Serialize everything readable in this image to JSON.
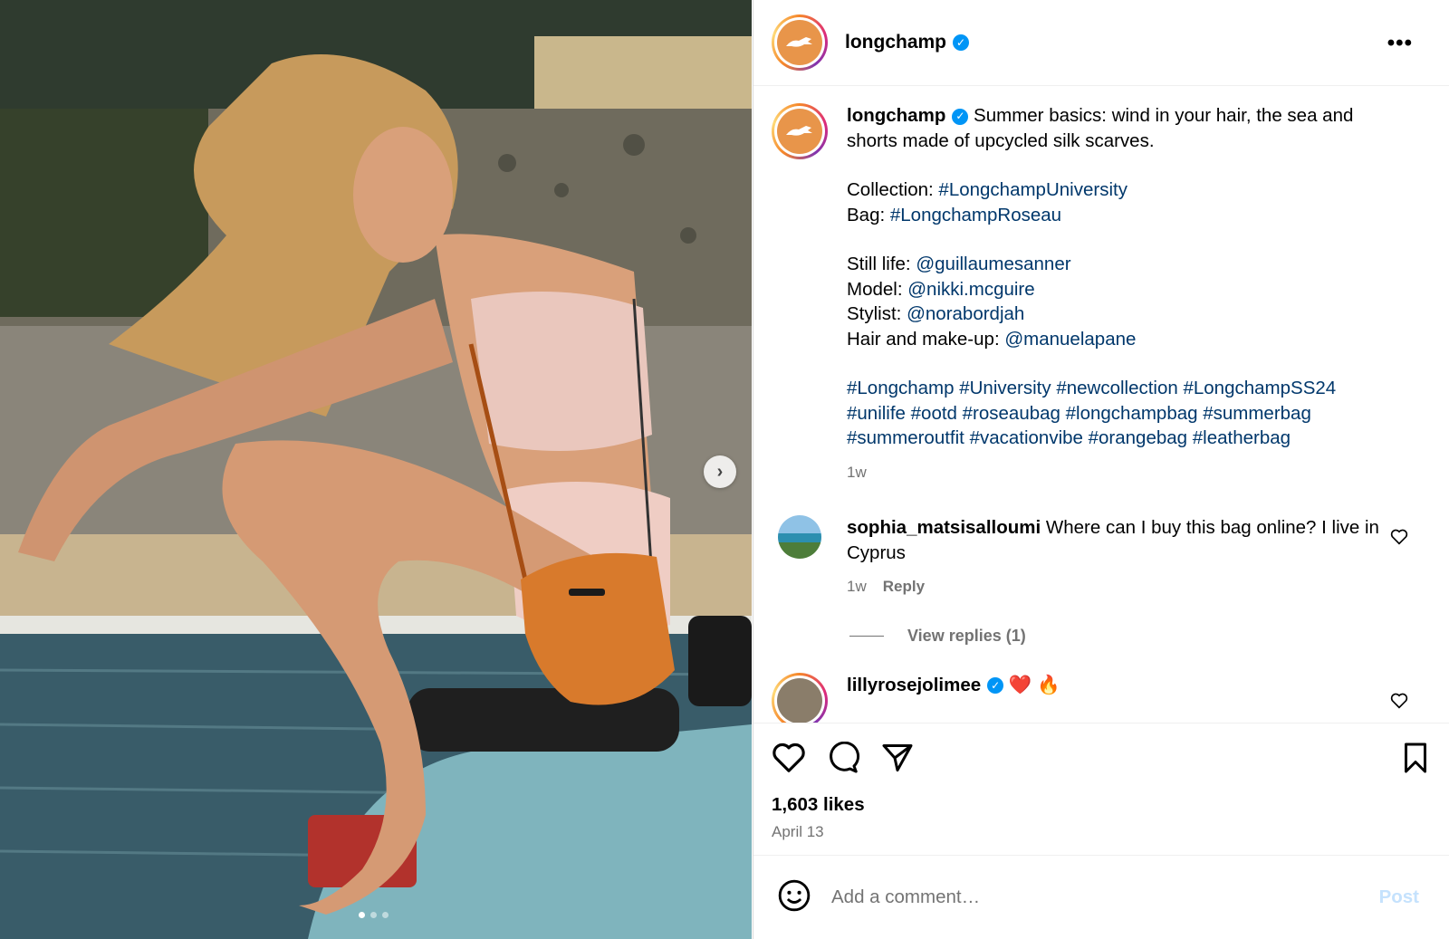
{
  "header": {
    "username": "longchamp",
    "more_label": "•••"
  },
  "caption": {
    "username": "longchamp",
    "text": "Summer basics: wind in your hair, the sea and shorts made of upcycled silk scarves.",
    "collection_label": "Collection: ",
    "collection_tag": "#LongchampUniversity",
    "bag_label": "Bag: ",
    "bag_tag": "#LongchampRoseau",
    "still_label": "Still life: ",
    "still_handle": "@guillaumesanner",
    "model_label": "Model: ",
    "model_handle": "@nikki.mcguire",
    "stylist_label": "Stylist: ",
    "stylist_handle": "@norabordjah",
    "hair_label": "Hair and make-up: ",
    "hair_handle": "@manuelapane",
    "hashtags_1": "#Longchamp #University #newcollection #LongchampSS24",
    "hashtags_2": "#unilife #ootd #roseaubag #longchampbag #summerbag",
    "hashtags_3": "#summeroutfit #vacationvibe #orangebag #leatherbag",
    "time": "1w"
  },
  "comments": [
    {
      "username": "sophia_matsisalloumi",
      "text": "Where can I buy this bag online? I live in Cyprus",
      "time": "1w",
      "reply": "Reply",
      "view_replies": "View replies (1)"
    },
    {
      "username": "lillyrosejolimee",
      "text": "❤️ 🔥"
    }
  ],
  "actions": {
    "likes": "1,603 likes",
    "date": "April 13"
  },
  "compose": {
    "placeholder": "Add a comment…",
    "post": "Post"
  },
  "carousel": {
    "next": "›",
    "total": 3,
    "active": 1
  }
}
